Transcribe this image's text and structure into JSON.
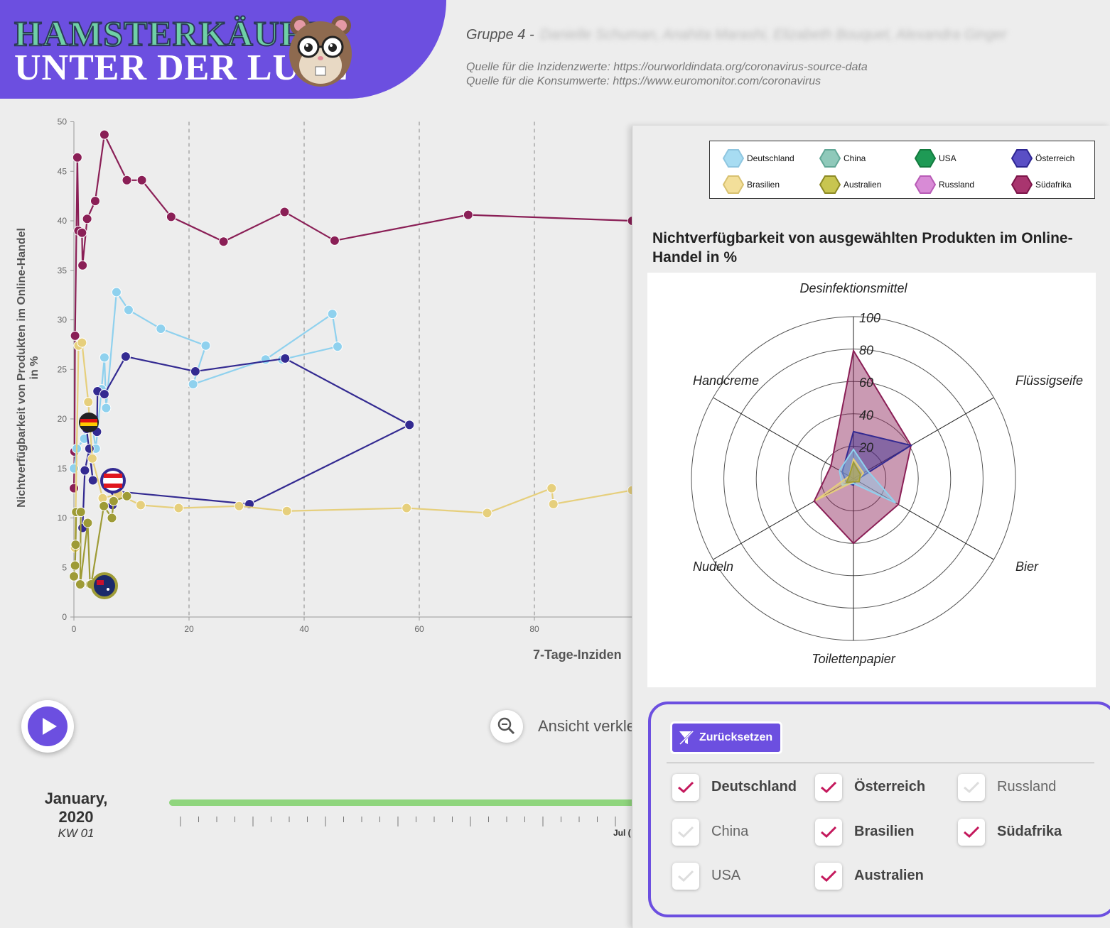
{
  "header": {
    "logo_line1": "HAMSTERKÄUFE",
    "logo_line2": "UNTER DER LUPE",
    "group_label": "Gruppe 4 -",
    "group_members": "Danielle Schuman, Anahita Marashi, Elizabeth Bouquet, Alexandra Ginger",
    "source_incidence": "Quelle für die Inzidenzwerte: https://ourworldindata.org/coronavirus-source-data",
    "source_consumption": "Quelle für die Konsumwerte: https://www.euromonitor.com/coronavirus"
  },
  "colors": {
    "accent": "#6c4fe0",
    "deutschland": "#8fd1ee",
    "china": "#77b5a6",
    "usa": "#1b8a4b",
    "oesterreich": "#332a91",
    "brasilien": "#e6cf7c",
    "australien": "#9e9b36",
    "russland": "#c873c6",
    "suedafrika": "#8a1f56"
  },
  "chart_data": [
    {
      "type": "scatter",
      "xlabel": "7-Tage-Inziden",
      "ylabel": "Nichtverfügbarkeit von Produkten im Online-Handel in %",
      "xlim": [
        0,
        97
      ],
      "ylim": [
        0,
        50
      ],
      "xticks": [
        0,
        20,
        40,
        60,
        80
      ],
      "yticks": [
        0,
        5,
        10,
        15,
        20,
        25,
        30,
        35,
        40,
        45,
        50
      ],
      "grid": "vertical dashed at 20, 40, 60, 80",
      "series": [
        {
          "name": "Südafrika",
          "color": "#8a1f56",
          "points": [
            [
              0,
              13
            ],
            [
              0.1,
              16.7
            ],
            [
              0.2,
              28.4
            ],
            [
              0.6,
              46.4
            ],
            [
              0.8,
              39
            ],
            [
              1.4,
              38.8
            ],
            [
              1.5,
              35.5
            ],
            [
              2.3,
              40.2
            ],
            [
              3.7,
              42
            ],
            [
              5.3,
              48.7
            ],
            [
              9.2,
              44.1
            ],
            [
              11.8,
              44.1
            ],
            [
              16.9,
              40.4
            ],
            [
              26,
              37.9
            ],
            [
              36.6,
              40.9
            ],
            [
              45.3,
              38
            ],
            [
              68.5,
              40.6
            ],
            [
              97,
              40
            ]
          ]
        },
        {
          "name": "Deutschland",
          "color": "#8fd1ee",
          "points": [
            [
              0,
              15
            ],
            [
              0.5,
              17
            ],
            [
              1.8,
              18
            ],
            [
              2.2,
              19.5
            ],
            [
              3,
              20
            ],
            [
              3.8,
              17
            ],
            [
              4.8,
              23
            ],
            [
              5.3,
              26.2
            ],
            [
              5.6,
              21.1
            ],
            [
              7.4,
              32.8
            ],
            [
              9.5,
              31
            ],
            [
              15.1,
              29.1
            ],
            [
              22.9,
              27.4
            ],
            [
              20.7,
              23.5
            ],
            [
              33.3,
              26
            ],
            [
              44.9,
              30.6
            ],
            [
              45.8,
              27.3
            ],
            [
              36.2,
              26
            ]
          ]
        },
        {
          "name": "Österreich",
          "color": "#332a91",
          "points": [
            [
              1.5,
              9
            ],
            [
              1.9,
              14.8
            ],
            [
              2.7,
              17
            ],
            [
              3.3,
              13.8
            ],
            [
              2.2,
              19
            ],
            [
              4,
              18.7
            ],
            [
              4.1,
              22.8
            ],
            [
              5.3,
              22.5
            ],
            [
              9,
              26.3
            ],
            [
              21.1,
              24.8
            ],
            [
              36.7,
              26.1
            ],
            [
              58.3,
              19.4
            ],
            [
              30.5,
              11.4
            ],
            [
              7,
              12.7
            ],
            [
              6.7,
              11.3
            ]
          ]
        },
        {
          "name": "Brasilien",
          "color": "#e6cf7c",
          "points": [
            [
              0.2,
              7
            ],
            [
              0.8,
              27.4
            ],
            [
              1.4,
              27.7
            ],
            [
              2.5,
              21.7
            ],
            [
              3.2,
              16
            ],
            [
              5,
              12
            ],
            [
              7.7,
              12.4
            ],
            [
              11.6,
              11.3
            ],
            [
              18.2,
              11
            ],
            [
              28.7,
              11.2
            ],
            [
              37,
              10.7
            ],
            [
              57.8,
              11
            ],
            [
              71.8,
              10.5
            ],
            [
              83,
              13
            ],
            [
              83.3,
              11.4
            ],
            [
              97,
              12.8
            ]
          ]
        },
        {
          "name": "Australien",
          "color": "#9e9b36",
          "points": [
            [
              0,
              4.1
            ],
            [
              0.2,
              5.2
            ],
            [
              0.3,
              7.3
            ],
            [
              0.4,
              10.6
            ],
            [
              1.2,
              10.6
            ],
            [
              1.1,
              3.3
            ],
            [
              2.4,
              9.5
            ],
            [
              2.8,
              3.3
            ],
            [
              3,
              3.3
            ],
            [
              5.2,
              11.2
            ],
            [
              6.6,
              10
            ],
            [
              6.9,
              11.7
            ],
            [
              9.2,
              12.2
            ]
          ]
        }
      ]
    },
    {
      "type": "radar",
      "title": "Nichtverfügbarkeit von ausgewählten Produkten im Online-Handel in %",
      "axes": [
        "Desinfektionsmittel",
        "Flüssigseife",
        "Bier",
        "Toilettenpapier",
        "Nudeln",
        "Handcreme"
      ],
      "ticks": [
        20,
        40,
        60,
        80,
        100
      ],
      "range": [
        0,
        100
      ],
      "series": [
        {
          "name": "Südafrika",
          "color": "#8a1f56",
          "values": [
            79,
            41,
            32,
            40,
            28,
            16
          ]
        },
        {
          "name": "Österreich",
          "color": "#332a91",
          "values": [
            29,
            41,
            2,
            4,
            5,
            8
          ]
        },
        {
          "name": "Deutschland",
          "color": "#8fd1ee",
          "values": [
            18,
            10,
            30,
            3,
            8,
            10
          ]
        },
        {
          "name": "Brasilien",
          "color": "#e6cf7c",
          "values": [
            12,
            7,
            3,
            2,
            27,
            3
          ]
        },
        {
          "name": "Australien",
          "color": "#9e9b36",
          "values": [
            10,
            5,
            4,
            2,
            5,
            3
          ]
        }
      ]
    }
  ],
  "legend": [
    {
      "label": "Deutschland",
      "color": "#a7dcf2",
      "stroke": "#8fc6e0"
    },
    {
      "label": "China",
      "color": "#8fc9ba",
      "stroke": "#62a897"
    },
    {
      "label": "USA",
      "color": "#1e9a55",
      "stroke": "#137a3e"
    },
    {
      "label": "Österreich",
      "color": "#5a4fc5",
      "stroke": "#2e2692"
    },
    {
      "label": "Brasilien",
      "color": "#f3df9a",
      "stroke": "#d8c170"
    },
    {
      "label": "Australien",
      "color": "#c8c550",
      "stroke": "#8d8a24"
    },
    {
      "label": "Russland",
      "color": "#d88bd6",
      "stroke": "#b85bb6"
    },
    {
      "label": "Südafrika",
      "color": "#a9356f",
      "stroke": "#7c1448"
    }
  ],
  "controls": {
    "zoom_label": "Ansicht verkle",
    "month": "January,",
    "year": "2020",
    "week": "KW 01",
    "timeline_marker": "Jul (",
    "reset_label": "Zurücksetzen"
  },
  "filters": [
    {
      "label": "Deutschland",
      "checked": true
    },
    {
      "label": "Österreich",
      "checked": true
    },
    {
      "label": "Russland",
      "checked": false
    },
    {
      "label": "China",
      "checked": false
    },
    {
      "label": "Brasilien",
      "checked": true
    },
    {
      "label": "Südafrika",
      "checked": true
    },
    {
      "label": "USA",
      "checked": false
    },
    {
      "label": "Australien",
      "checked": true
    }
  ]
}
